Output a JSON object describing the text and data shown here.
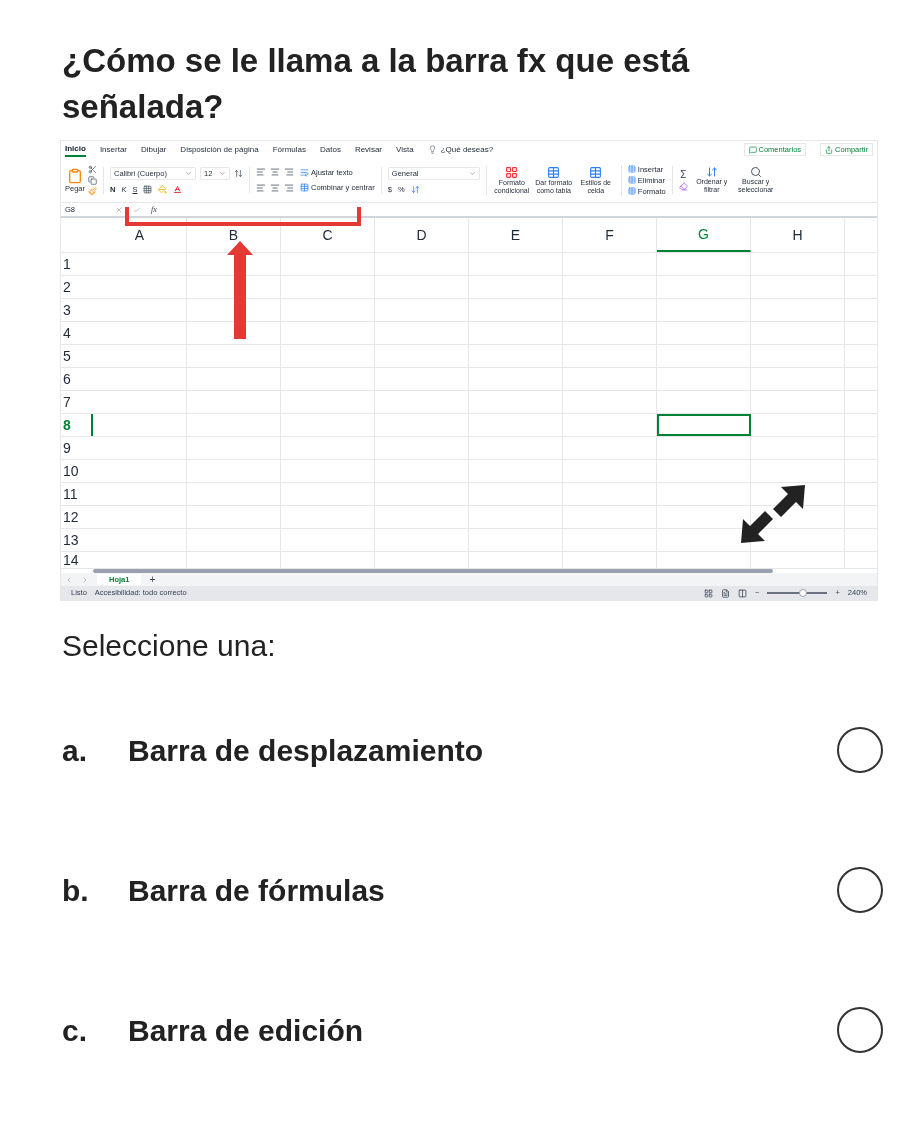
{
  "question": "¿Cómo se le llama a la barra fx que está señalada?",
  "excel": {
    "ribbon_tabs": [
      {
        "label": "Inicio",
        "selected": true
      },
      {
        "label": "Insertar",
        "selected": false
      },
      {
        "label": "Dibujar",
        "selected": false
      },
      {
        "label": "Disposición de página",
        "selected": false
      },
      {
        "label": "Fórmulas",
        "selected": false
      },
      {
        "label": "Datos",
        "selected": false
      },
      {
        "label": "Revisar",
        "selected": false
      },
      {
        "label": "Vista",
        "selected": false
      }
    ],
    "tell_me": "¿Qué deseas?",
    "comments": "Comentarios",
    "share": "Compartir",
    "paste": "Pegar",
    "font_name": "Calibri (Cuerpo)",
    "font_size": "12",
    "bold": "N",
    "italic": "K",
    "underline": "S",
    "wrap_text": "Ajustar texto",
    "merge": "Combinar y centrar",
    "number_format": "General",
    "currency": "$",
    "percent": "%",
    "styles": [
      "Formato condicional",
      "Dar formato como tabla",
      "Estilos de celda"
    ],
    "cells": [
      "Insertar",
      "Eliminar",
      "Formato"
    ],
    "sum": "Σ",
    "editing": [
      "Ordenar y filtrar",
      "Buscar y seleccionar"
    ],
    "name_box": "G8",
    "fx": "fx",
    "columns": [
      {
        "label": "A",
        "selected": false
      },
      {
        "label": "B",
        "selected": false
      },
      {
        "label": "C",
        "selected": false
      },
      {
        "label": "D",
        "selected": false
      },
      {
        "label": "E",
        "selected": false
      },
      {
        "label": "F",
        "selected": false
      },
      {
        "label": "G",
        "selected": true
      },
      {
        "label": "H",
        "selected": false
      }
    ],
    "rows": [
      {
        "label": "1",
        "selected": false
      },
      {
        "label": "2",
        "selected": false
      },
      {
        "label": "3",
        "selected": false
      },
      {
        "label": "4",
        "selected": false
      },
      {
        "label": "5",
        "selected": false
      },
      {
        "label": "6",
        "selected": false
      },
      {
        "label": "7",
        "selected": false
      },
      {
        "label": "8",
        "selected": true
      },
      {
        "label": "9",
        "selected": false
      },
      {
        "label": "10",
        "selected": false
      },
      {
        "label": "11",
        "selected": false
      },
      {
        "label": "12",
        "selected": false
      },
      {
        "label": "13",
        "selected": false
      },
      {
        "label": "14",
        "selected": false
      }
    ],
    "sheet_tabs": [
      {
        "label": "Hoja1",
        "selected": true
      }
    ],
    "add_sheet": "+",
    "status": "Listo",
    "accessibility": "Accesibilidad: todo correcto",
    "zoom_minus": "−",
    "zoom_plus": "+",
    "zoom": {
      "level": 0.6
    },
    "zoom_reading": "240%"
  },
  "prompt": "Seleccione una:",
  "options": [
    {
      "letter": "a.",
      "text": "Barra de desplazamiento",
      "selected": false
    },
    {
      "letter": "b.",
      "text": "Barra de fórmulas",
      "selected": false
    },
    {
      "letter": "c.",
      "text": "Barra de edición",
      "selected": false
    }
  ]
}
